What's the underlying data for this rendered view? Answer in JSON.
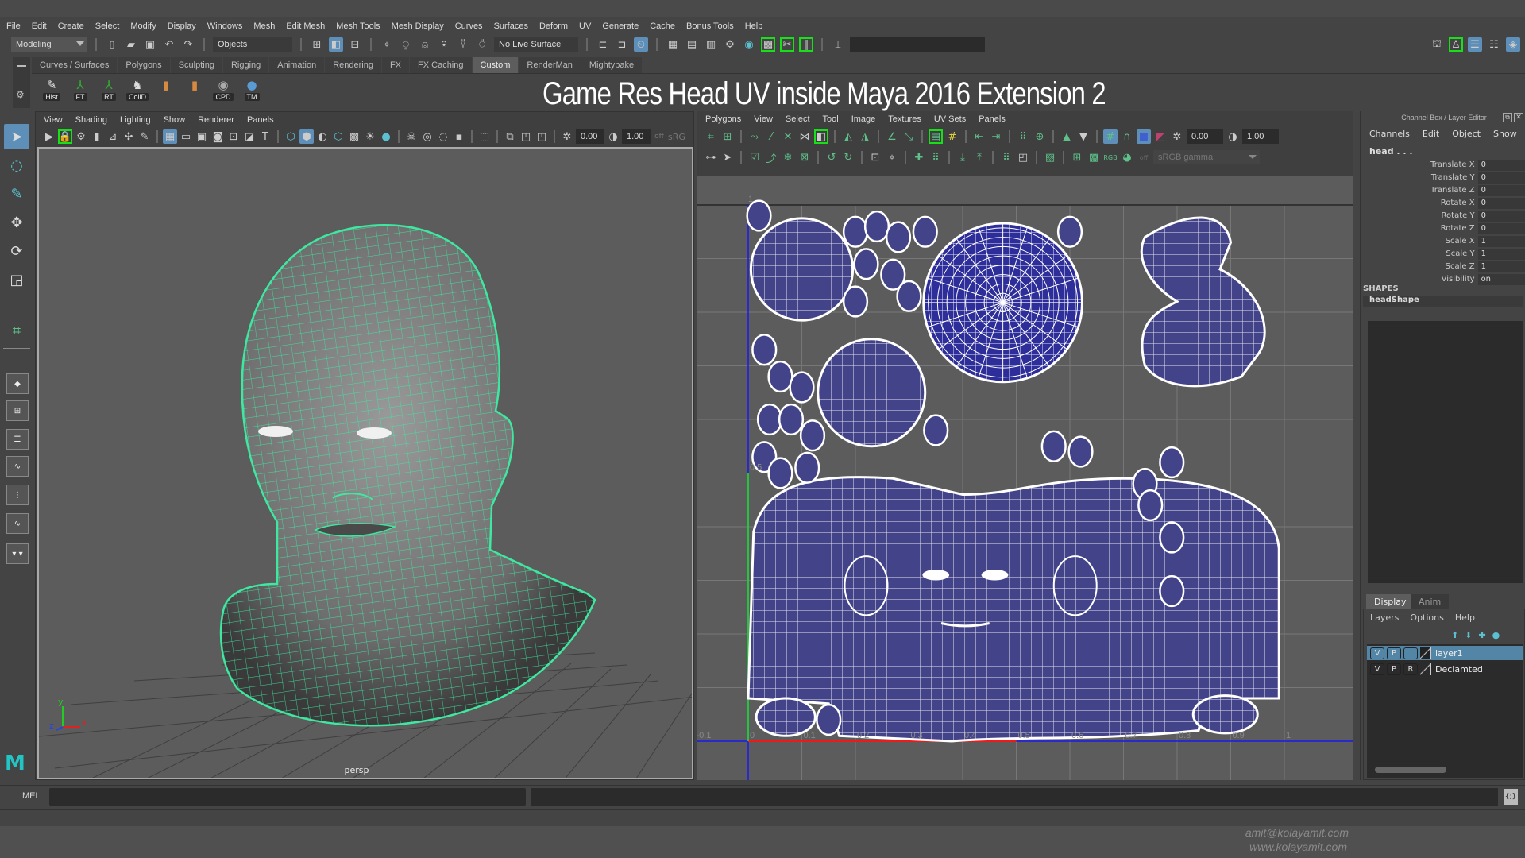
{
  "overlay_title": "Game Res Head UV inside Maya 2016 Extension 2",
  "menubar": [
    "File",
    "Edit",
    "Create",
    "Select",
    "Modify",
    "Display",
    "Windows",
    "Mesh",
    "Edit Mesh",
    "Mesh Tools",
    "Mesh Display",
    "Curves",
    "Surfaces",
    "Deform",
    "UV",
    "Generate",
    "Cache",
    "Bonus Tools",
    "Help"
  ],
  "statusline": {
    "workspace": "Modeling",
    "selection_mode": "Objects",
    "live_surface": "No Live Surface"
  },
  "shelf_tabs": [
    {
      "label": "Curves / Surfaces",
      "active": false
    },
    {
      "label": "Polygons",
      "active": false
    },
    {
      "label": "Sculpting",
      "active": false
    },
    {
      "label": "Rigging",
      "active": false
    },
    {
      "label": "Animation",
      "active": false
    },
    {
      "label": "Rendering",
      "active": false
    },
    {
      "label": "FX",
      "active": false
    },
    {
      "label": "FX Caching",
      "active": false
    },
    {
      "label": "Custom",
      "active": true
    },
    {
      "label": "RenderMan",
      "active": false
    },
    {
      "label": "Mightybake",
      "active": false
    }
  ],
  "shelf_buttons": [
    {
      "label": "Hist",
      "icon": "pencil-icon"
    },
    {
      "label": "FT",
      "icon": "axis-icon"
    },
    {
      "label": "RT",
      "icon": "axis-icon"
    },
    {
      "label": "CollD",
      "icon": "python-icon"
    },
    {
      "label": "",
      "icon": "mesh-orange-icon"
    },
    {
      "label": "",
      "icon": "mesh-orange-icon"
    },
    {
      "label": "CPD",
      "icon": "eye-icon"
    },
    {
      "label": "TM",
      "icon": "sphere-icon"
    }
  ],
  "viewport": {
    "menu": [
      "View",
      "Shading",
      "Lighting",
      "Show",
      "Renderer",
      "Panels"
    ],
    "exposure": "0.00",
    "gamma": "1.00",
    "color_space": "sRG",
    "camera_label": "persp",
    "axis": {
      "x": "x",
      "y": "y",
      "z": "z"
    }
  },
  "uv_editor": {
    "menu": [
      "Polygons",
      "View",
      "Select",
      "Tool",
      "Image",
      "Textures",
      "UV Sets",
      "Panels"
    ],
    "exposure": "0.00",
    "gamma": "1.00",
    "color_space": "sRGB gamma",
    "u_ticks": [
      "-0.1",
      "0",
      "0.1",
      "0.2",
      "0.3",
      "0.4",
      "0.5",
      "0.6",
      "0.7",
      "0.8",
      "0.9",
      "1"
    ],
    "v_ticks": [
      "1",
      "0.5"
    ],
    "shell_fill": "#43438a",
    "shell_fill_selected": "#2e2e9a"
  },
  "channel_box": {
    "title": "Channel Box / Layer Editor",
    "menu": [
      "Channels",
      "Edit",
      "Object",
      "Show"
    ],
    "object": "head . . .",
    "channels": [
      {
        "name": "Translate X",
        "value": "0"
      },
      {
        "name": "Translate Y",
        "value": "0"
      },
      {
        "name": "Translate Z",
        "value": "0"
      },
      {
        "name": "Rotate X",
        "value": "0"
      },
      {
        "name": "Rotate Y",
        "value": "0"
      },
      {
        "name": "Rotate Z",
        "value": "0"
      },
      {
        "name": "Scale X",
        "value": "1"
      },
      {
        "name": "Scale Y",
        "value": "1"
      },
      {
        "name": "Scale Z",
        "value": "1"
      },
      {
        "name": "Visibility",
        "value": "on"
      }
    ],
    "shapes_header": "SHAPES",
    "shape": "headShape"
  },
  "layer_editor": {
    "tabs": [
      {
        "label": "Display",
        "active": true
      },
      {
        "label": "Anim",
        "active": false
      }
    ],
    "menu": [
      "Layers",
      "Options",
      "Help"
    ],
    "layers": [
      {
        "v": "V",
        "p": "P",
        "r": "",
        "name": "layer1",
        "selected": true
      },
      {
        "v": "V",
        "p": "P",
        "r": "R",
        "name": "Deciamted",
        "selected": false
      }
    ]
  },
  "command_line": {
    "label": "MEL",
    "value": ""
  },
  "watermark": [
    "amit@kolayamit.com",
    "www.kolayamit.com"
  ],
  "colors": {
    "wireframe": "#3ee8a0",
    "selection": "#5d8fb8",
    "highlight": "#18e018"
  }
}
